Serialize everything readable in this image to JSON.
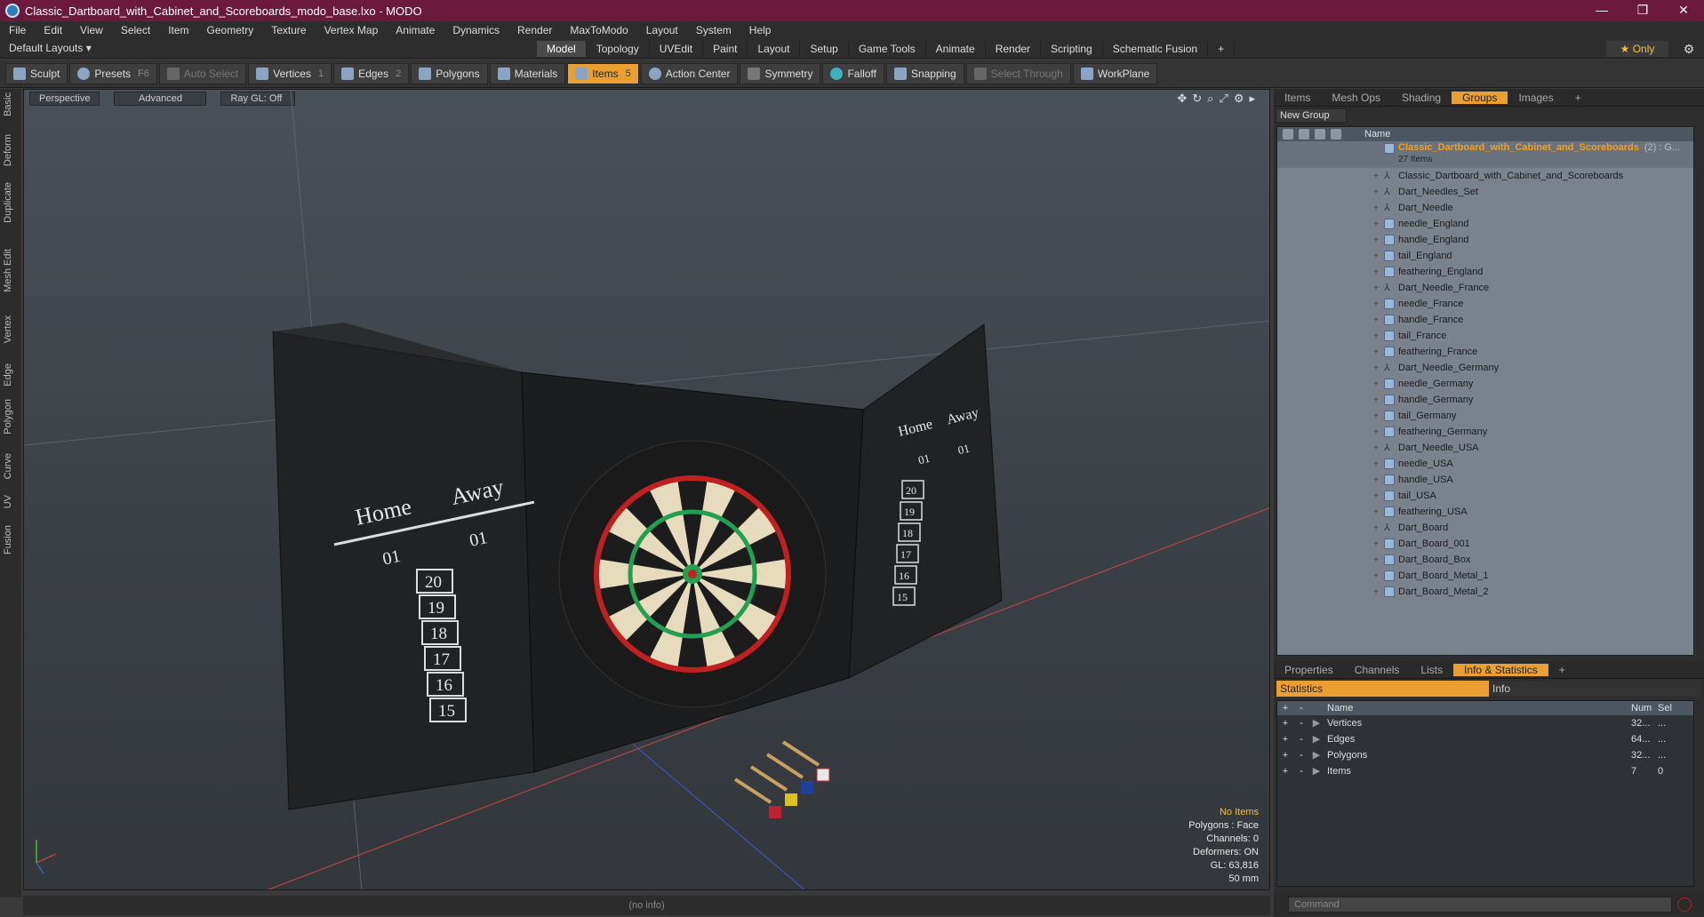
{
  "window": {
    "title": "Classic_Dartboard_with_Cabinet_and_Scoreboards_modo_base.lxo - MODO",
    "controls": [
      "—",
      "❐",
      "✕"
    ]
  },
  "menu": [
    "File",
    "Edit",
    "View",
    "Select",
    "Item",
    "Geometry",
    "Texture",
    "Vertex Map",
    "Animate",
    "Dynamics",
    "Render",
    "MaxToModo",
    "Layout",
    "System",
    "Help"
  ],
  "tabbar": {
    "layouts_label": "Default Layouts ▾",
    "tabs": [
      "Model",
      "Topology",
      "UVEdit",
      "Paint",
      "Layout",
      "Setup",
      "Game Tools",
      "Animate",
      "Render",
      "Scripting",
      "Schematic Fusion",
      "+"
    ],
    "active_tab": "Model",
    "only_label": "★ Only"
  },
  "toolbar": {
    "sculpt": "Sculpt",
    "presets": "Presets",
    "presets_key": "F6",
    "auto_select": "Auto Select",
    "vertices": "Vertices",
    "vertices_num": "1",
    "edges": "Edges",
    "edges_num": "2",
    "polygons": "Polygons",
    "materials": "Materials",
    "items": "Items",
    "items_num": "5",
    "action_center": "Action Center",
    "symmetry": "Symmetry",
    "falloff": "Falloff",
    "snapping": "Snapping",
    "select_through": "Select Through",
    "workplane": "WorkPlane"
  },
  "left_tabs": [
    "Basic",
    "Deform",
    "Duplicate",
    "Mesh Edit",
    "Vertex",
    "Edge",
    "Polygon",
    "Curve",
    "UV",
    "Fusion"
  ],
  "viewport": {
    "view_mode": "Perspective",
    "shading": "Advanced",
    "ray_gl": "Ray GL: Off",
    "info_selection": "No Items",
    "info_polygons": "Polygons : Face",
    "info_channels": "Channels: 0",
    "info_deformers": "Deformers: ON",
    "info_gl": "GL: 63,816",
    "info_focal": "50 mm",
    "scoreboard_left": {
      "home": "Home",
      "away": "Away",
      "score_left": "01",
      "score_right": "01",
      "numbers": [
        "20",
        "19",
        "18",
        "17",
        "16",
        "15"
      ]
    },
    "scoreboard_right": {
      "home": "Home",
      "away": "Away",
      "score_left": "01",
      "score_right": "01",
      "numbers": [
        "20",
        "19",
        "18",
        "17",
        "16",
        "15"
      ]
    }
  },
  "status_bar": "(no info)",
  "right_panel": {
    "top_tabs": [
      "Items",
      "Mesh Ops",
      "Shading",
      "Groups",
      "Images",
      "+"
    ],
    "active_top_tab": "Groups",
    "new_group": "New Group",
    "name_header": "Name",
    "group": {
      "name": "Classic_Dartboard_with_Cabinet_and_Scoreboards",
      "tail": "(2) : G...",
      "count": "27 Items"
    },
    "items": [
      {
        "name": "Classic_Dartboard_with_Cabinet_and_Scoreboards",
        "type": "locator"
      },
      {
        "name": "Dart_Needles_Set",
        "type": "locator"
      },
      {
        "name": "Dart_Needle",
        "type": "locator"
      },
      {
        "name": "needle_England",
        "type": "mesh"
      },
      {
        "name": "handle_England",
        "type": "mesh"
      },
      {
        "name": "tail_England",
        "type": "mesh"
      },
      {
        "name": "feathering_England",
        "type": "mesh"
      },
      {
        "name": "Dart_Needle_France",
        "type": "locator"
      },
      {
        "name": "needle_France",
        "type": "mesh"
      },
      {
        "name": "handle_France",
        "type": "mesh"
      },
      {
        "name": "tail_France",
        "type": "mesh"
      },
      {
        "name": "feathering_France",
        "type": "mesh"
      },
      {
        "name": "Dart_Needle_Germany",
        "type": "locator"
      },
      {
        "name": "needle_Germany",
        "type": "mesh"
      },
      {
        "name": "handle_Germany",
        "type": "mesh"
      },
      {
        "name": "tail_Germany",
        "type": "mesh"
      },
      {
        "name": "feathering_Germany",
        "type": "mesh"
      },
      {
        "name": "Dart_Needle_USA",
        "type": "locator"
      },
      {
        "name": "needle_USA",
        "type": "mesh"
      },
      {
        "name": "handle_USA",
        "type": "mesh"
      },
      {
        "name": "tail_USA",
        "type": "mesh"
      },
      {
        "name": "feathering_USA",
        "type": "mesh"
      },
      {
        "name": "Dart_Board",
        "type": "locator"
      },
      {
        "name": "Dart_Board_001",
        "type": "mesh"
      },
      {
        "name": "Dart_Board_Box",
        "type": "mesh"
      },
      {
        "name": "Dart_Board_Metal_1",
        "type": "mesh"
      },
      {
        "name": "Dart_Board_Metal_2",
        "type": "mesh"
      }
    ],
    "bottom_tabs": [
      "Properties",
      "Channels",
      "Lists",
      "Info & Statistics",
      "+"
    ],
    "active_bottom_tab": "Info & Statistics",
    "stat_tabs": [
      "Statistics",
      "Info"
    ],
    "stat_headers": {
      "name": "Name",
      "num": "Num",
      "sel": "Sel"
    },
    "stats": [
      {
        "name": "Vertices",
        "num": "32...",
        "sel": "..."
      },
      {
        "name": "Edges",
        "num": "64...",
        "sel": "..."
      },
      {
        "name": "Polygons",
        "num": "32...",
        "sel": "..."
      },
      {
        "name": "Items",
        "num": "7",
        "sel": "0"
      }
    ],
    "command_placeholder": "Command"
  },
  "colors": {
    "titlebar": "#6b1a3c",
    "accent": "#e9a030",
    "group_name": "#f0a020"
  }
}
